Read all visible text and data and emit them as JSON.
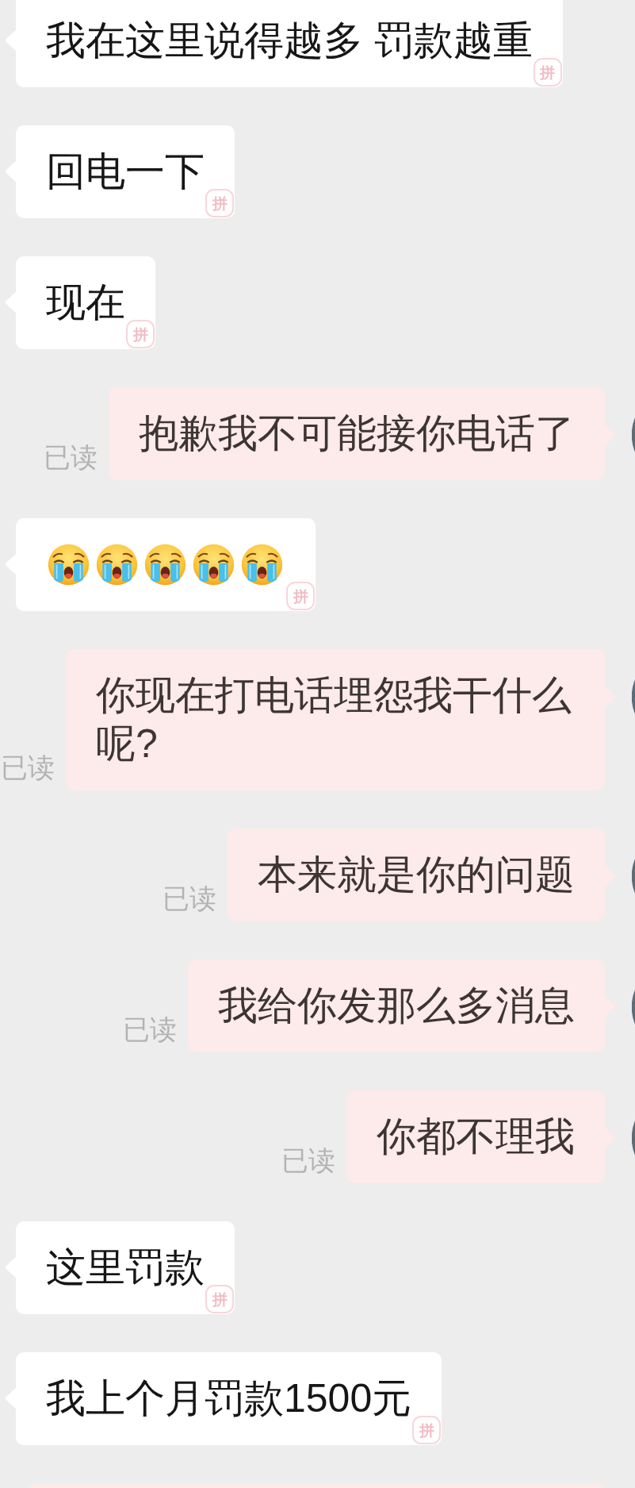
{
  "messages": [
    {
      "outgoing": false,
      "kind": "text",
      "text": "我在这里说得越多 罚款越重",
      "stamp": "拼"
    },
    {
      "outgoing": false,
      "kind": "text",
      "text": "回电一下",
      "stamp": "拼"
    },
    {
      "outgoing": false,
      "kind": "text",
      "text": "现在",
      "stamp": "拼"
    },
    {
      "outgoing": true,
      "kind": "text",
      "text": "抱歉我不可能接你电话了",
      "status": "已读"
    },
    {
      "outgoing": false,
      "kind": "emoji",
      "emojis": [
        {
          "kind": "loudly-crying"
        },
        {
          "kind": "loudly-crying"
        },
        {
          "kind": "loudly-crying"
        },
        {
          "kind": "loudly-crying"
        },
        {
          "kind": "loudly-crying"
        }
      ],
      "stamp": "拼"
    },
    {
      "outgoing": true,
      "kind": "text",
      "text": "你现在打电话埋怨我干什么呢?",
      "status": "已读"
    },
    {
      "outgoing": true,
      "kind": "text",
      "text": "本来就是你的问题",
      "status": "已读"
    },
    {
      "outgoing": true,
      "kind": "text",
      "text": "我给你发那么多消息",
      "status": "已读"
    },
    {
      "outgoing": true,
      "kind": "text",
      "text": "你都不理我",
      "status": "已读"
    },
    {
      "outgoing": false,
      "kind": "text",
      "text": "这里罚款",
      "stamp": "拼"
    },
    {
      "outgoing": false,
      "kind": "text",
      "text": "我上个月罚款1500元",
      "stamp": "拼"
    },
    {
      "outgoing": true,
      "kind": "cut"
    }
  ]
}
